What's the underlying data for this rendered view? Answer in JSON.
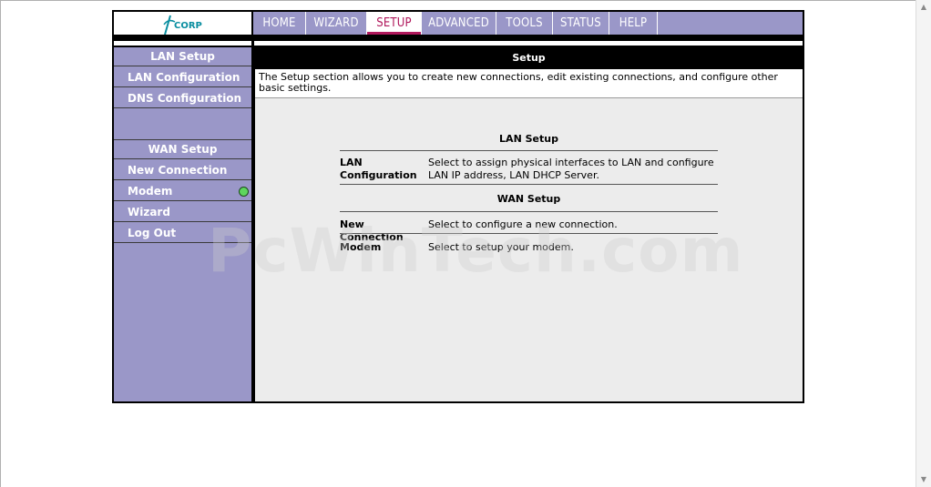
{
  "brand": {
    "logo_text": "ACORP",
    "color": "#0a8ea0"
  },
  "nav": {
    "tabs": [
      {
        "label": "HOME",
        "active": false
      },
      {
        "label": "WIZARD",
        "active": false
      },
      {
        "label": "SETUP",
        "active": true
      },
      {
        "label": "ADVANCED",
        "active": false
      },
      {
        "label": "TOOLS",
        "active": false
      },
      {
        "label": "STATUS",
        "active": false
      },
      {
        "label": "HELP",
        "active": false
      }
    ]
  },
  "sidebar": {
    "lan_header": "LAN Setup",
    "lan_items": [
      "LAN Configuration",
      "DNS Configuration"
    ],
    "wan_header": "WAN Setup",
    "wan_items": [
      "New Connection",
      "Modem",
      "Wizard",
      "Log Out"
    ]
  },
  "main": {
    "title": "Setup",
    "description": "The Setup section allows you to create new connections, edit existing connections, and configure other basic settings.",
    "lan_section": {
      "title": "LAN Setup",
      "rows": [
        {
          "label": "LAN Configuration",
          "text": "Select to assign physical interfaces to LAN and configure LAN IP address, LAN DHCP Server."
        }
      ]
    },
    "wan_section": {
      "title": "WAN Setup",
      "rows": [
        {
          "label": "New Connection",
          "text": "Select to configure a new connection."
        },
        {
          "label": "Modem",
          "text": "Select to setup your modem."
        }
      ]
    }
  },
  "watermark": "PcWinTech.com",
  "colors": {
    "nav_bg": "#9a97c8",
    "active_tab": "#b0185c",
    "sidebar_bg": "#9a97c8",
    "status_ok": "#5ed65e"
  }
}
